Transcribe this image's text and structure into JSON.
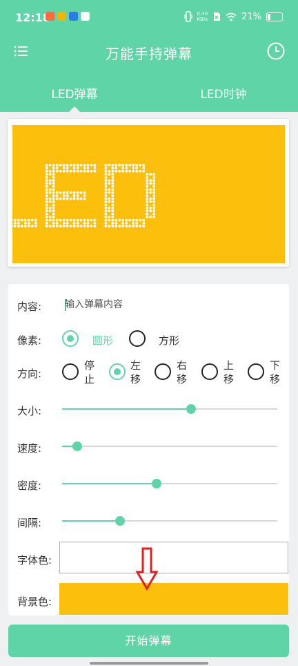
{
  "status_bar": {
    "time": "12:18",
    "net_speed_value": "0.30",
    "net_speed_unit": "KB/s",
    "battery": "21%"
  },
  "toolbar": {
    "title": "万能手持弹幕"
  },
  "tabs": [
    {
      "label": "LED弹幕",
      "active": true
    },
    {
      "label": "LED时钟",
      "active": false
    }
  ],
  "preview": {
    "text": "LED",
    "background_color": "#fcc00c",
    "dot_color": "#ffffff"
  },
  "form": {
    "content": {
      "label": "内容:",
      "placeholder": "输入弹幕内容",
      "value": ""
    },
    "pixel": {
      "label": "像素:",
      "options": [
        {
          "label": "圆形",
          "selected": true
        },
        {
          "label": "方形",
          "selected": false
        }
      ]
    },
    "direction": {
      "label": "方向:",
      "options": [
        {
          "label": "停止",
          "selected": false
        },
        {
          "label": "左移",
          "selected": true
        },
        {
          "label": "右移",
          "selected": false
        },
        {
          "label": "上移",
          "selected": false
        },
        {
          "label": "下移",
          "selected": false
        }
      ]
    },
    "size": {
      "label": "大小:",
      "value": 0.6
    },
    "speed": {
      "label": "速度:",
      "value": 0.07
    },
    "density": {
      "label": "密度:",
      "value": 0.44
    },
    "interval": {
      "label": "间隔:",
      "value": 0.27
    },
    "font_color": {
      "label": "字体色:",
      "color": "#ffffff"
    },
    "bg_color": {
      "label": "背景色:",
      "color": "#fcc00c"
    }
  },
  "start_button": {
    "label": "开始弹幕"
  },
  "colors": {
    "primary": "#5fd4a6",
    "accent_arrow": "#e02020"
  }
}
